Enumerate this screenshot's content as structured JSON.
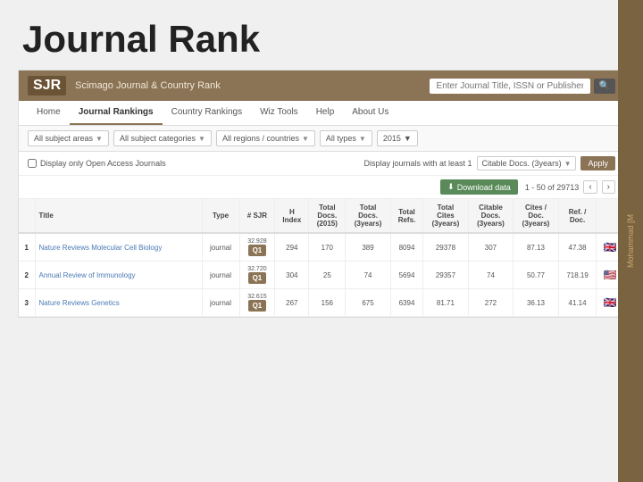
{
  "page": {
    "title": "Journal Rank"
  },
  "sjr": {
    "logo": "SJR",
    "tagline": "Scimago Journal & Country Rank",
    "search_placeholder": "Enter Journal Title, ISSN or Publisher Name..."
  },
  "nav": {
    "items": [
      {
        "label": "Home",
        "active": false
      },
      {
        "label": "Journal Rankings",
        "active": true
      },
      {
        "label": "Country Rankings",
        "active": false
      },
      {
        "label": "Wiz Tools",
        "active": false
      },
      {
        "label": "Help",
        "active": false
      },
      {
        "label": "About Us",
        "active": false
      }
    ]
  },
  "filters": {
    "subject_areas": "All subject areas",
    "subject_categories": "All subject categories",
    "regions": "All regions / countries",
    "types": "All types",
    "year": "2015"
  },
  "options": {
    "open_access_label": "Display only Open Access Journals",
    "display_at_least_label": "Display journals with at least 1",
    "citable_docs_label": "Citable Docs. (3years)",
    "apply_label": "Apply"
  },
  "toolbar": {
    "download_label": "Download data",
    "pagination_info": "1 - 50 of 29713"
  },
  "table": {
    "headers": [
      "",
      "Title",
      "Type",
      "# SJR",
      "H Index",
      "Total Docs. (2015)",
      "Total Docs. (3years)",
      "Total Refs.",
      "Total Cites (3years)",
      "Citable Docs (3years)",
      "Cites / Doc (3years)",
      "Ref / Doc."
    ],
    "rows": [
      {
        "rank": "1",
        "title": "Nature Reviews Molecular Cell Biology",
        "type": "journal",
        "sjr_value": "32.928",
        "sjr_quartile": "Q1",
        "h_index": "294",
        "total_docs_2015": "170",
        "total_docs_3y": "389",
        "total_refs": "8094",
        "total_cites_3y": "29378",
        "citable_docs_3y": "307",
        "cites_per_doc": "87.13",
        "ref_per_doc": "47.38",
        "flag": "gb"
      },
      {
        "rank": "2",
        "title": "Annual Review of Immunology",
        "type": "journal",
        "sjr_value": "32.720",
        "sjr_quartile": "Q1",
        "h_index": "304",
        "total_docs_2015": "25",
        "total_docs_3y": "74",
        "total_refs": "5694",
        "total_cites_3y": "29357",
        "citable_docs_3y": "74",
        "cites_per_doc": "50.77",
        "ref_per_doc": "718.19",
        "flag": "us"
      },
      {
        "rank": "3",
        "title": "Nature Reviews Genetics",
        "type": "journal",
        "sjr_value": "32.615",
        "sjr_quartile": "Q1",
        "h_index": "267",
        "total_docs_2015": "156",
        "total_docs_3y": "675",
        "total_refs": "6394",
        "total_cites_3y": "81.71",
        "citable_docs_3y": "272",
        "cites_per_doc": "36.13",
        "ref_per_doc": "41.14",
        "flag": "gb"
      }
    ]
  },
  "watermark": {
    "text": "Mohammad [M"
  }
}
